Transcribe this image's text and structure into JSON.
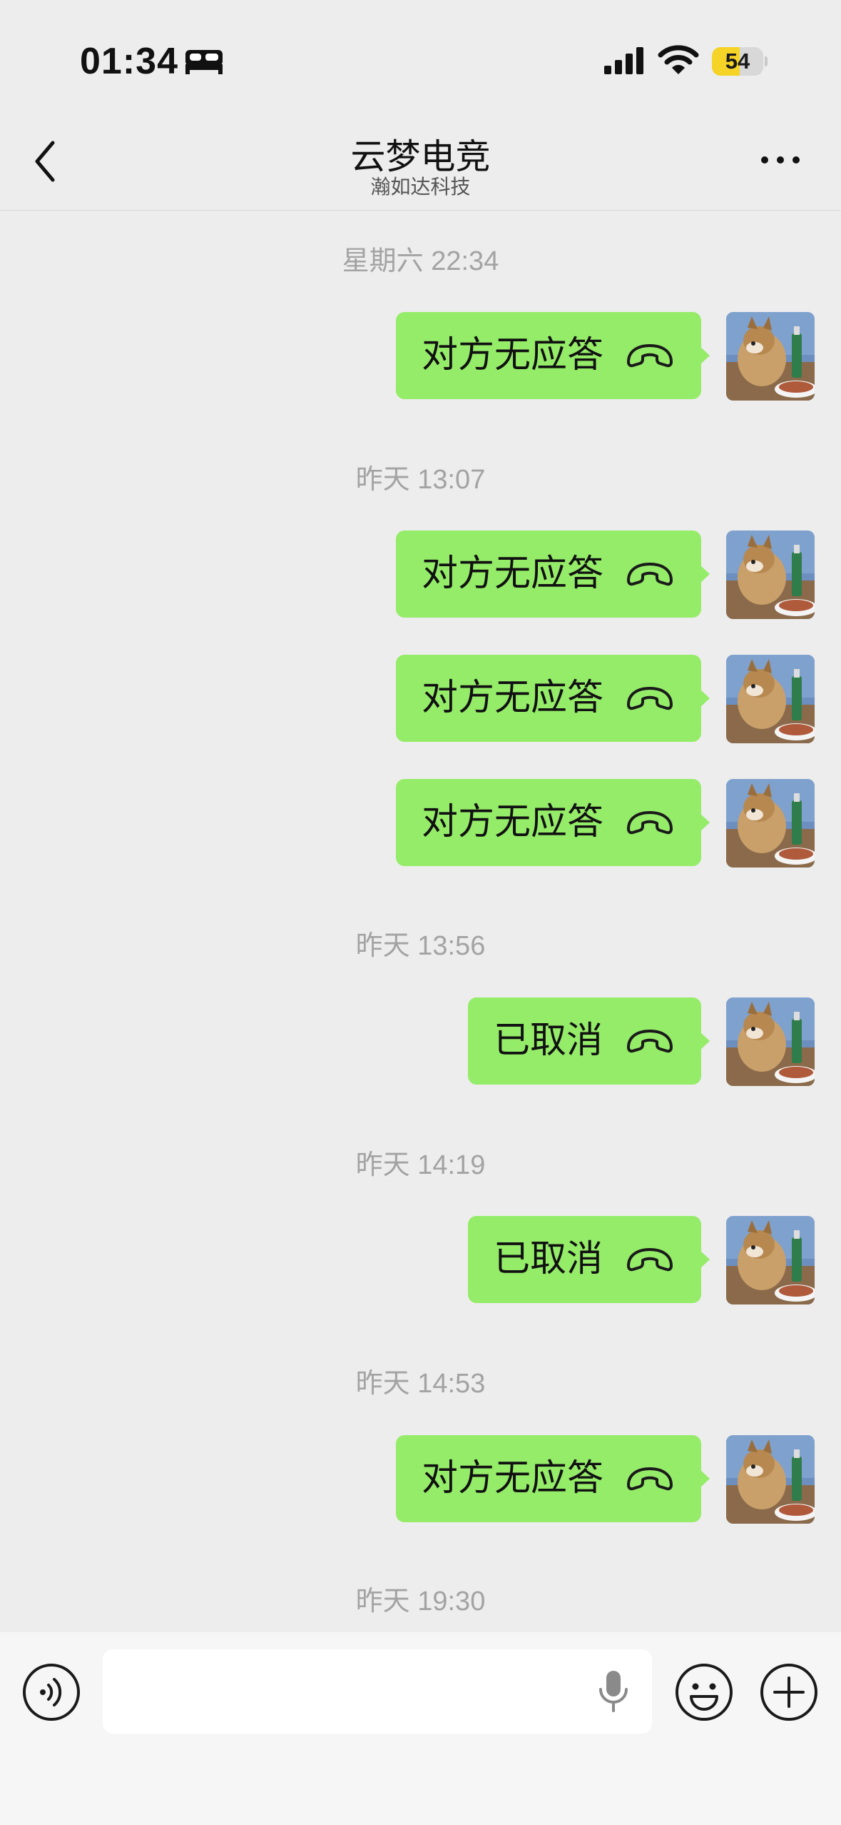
{
  "status_bar": {
    "time": "01:34",
    "battery": "54",
    "battery_level": 0.54,
    "left_icon": "bed-icon",
    "signal_icon": "cellular-signal-icon",
    "wifi_icon": "wifi-icon",
    "battery_color": "#f5d327"
  },
  "header": {
    "title": "云梦电竞",
    "subtitle": "瀚如达科技",
    "back_icon": "chevron-left-icon",
    "more_icon": "more-dots-icon"
  },
  "colors": {
    "bubble": "#95ec69",
    "background": "#ededed",
    "timestamp": "#a3a3a3"
  },
  "messages": [
    {
      "type": "time",
      "text": "星期六 22:34"
    },
    {
      "type": "call",
      "text": "对方无应答",
      "icon": "phone-hangup-icon"
    },
    {
      "type": "time",
      "text": "昨天 13:07"
    },
    {
      "type": "call",
      "text": "对方无应答",
      "icon": "phone-hangup-icon"
    },
    {
      "type": "call",
      "text": "对方无应答",
      "icon": "phone-hangup-icon"
    },
    {
      "type": "call",
      "text": "对方无应答",
      "icon": "phone-hangup-icon"
    },
    {
      "type": "time",
      "text": "昨天 13:56"
    },
    {
      "type": "call",
      "text": "已取消",
      "icon": "phone-hangup-icon"
    },
    {
      "type": "time",
      "text": "昨天 14:19"
    },
    {
      "type": "call",
      "text": "已取消",
      "icon": "phone-hangup-icon"
    },
    {
      "type": "time",
      "text": "昨天 14:53"
    },
    {
      "type": "call",
      "text": "对方无应答",
      "icon": "phone-hangup-icon"
    },
    {
      "type": "time",
      "text": "昨天 19:30"
    }
  ],
  "input_bar": {
    "text_value": "",
    "voice_icon": "voice-input-icon",
    "mic_icon": "microphone-icon",
    "emoji_icon": "emoji-icon",
    "plus_icon": "plus-icon"
  }
}
